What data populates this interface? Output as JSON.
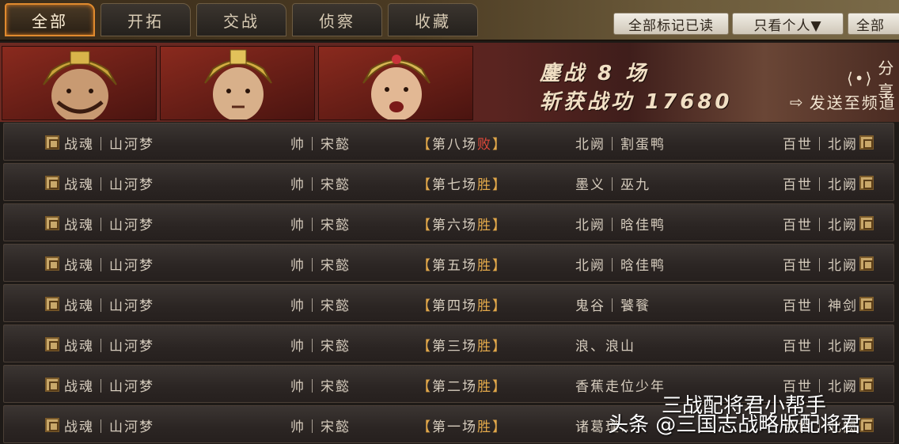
{
  "tabs": [
    {
      "label": "全部",
      "active": true
    },
    {
      "label": "开拓",
      "active": false
    },
    {
      "label": "交战",
      "active": false
    },
    {
      "label": "侦察",
      "active": false
    },
    {
      "label": "收藏",
      "active": false
    }
  ],
  "toolbar": {
    "mark_all_read": "全部标记已读",
    "filter_personal": "只看个人▼",
    "filter_all": "全部"
  },
  "banner": {
    "battles_text": "鏖战 8 场",
    "merit_text": "斩获战功 17680",
    "share_label": "分享",
    "send_label": "发送至频道"
  },
  "battles": [
    {
      "left_team": "战魂｜山河梦",
      "left_general": "帅｜宋懿",
      "round": "第八场",
      "result": "败",
      "result_type": "lose",
      "right_general": "北阙｜割蛋鸭",
      "right_team": "百世｜北阙"
    },
    {
      "left_team": "战魂｜山河梦",
      "left_general": "帅｜宋懿",
      "round": "第七场",
      "result": "胜",
      "result_type": "win",
      "right_general": "墨义｜巫九",
      "right_team": "百世｜北阙"
    },
    {
      "left_team": "战魂｜山河梦",
      "left_general": "帅｜宋懿",
      "round": "第六场",
      "result": "胜",
      "result_type": "win",
      "right_general": "北阙｜晗佳鸭",
      "right_team": "百世｜北阙"
    },
    {
      "left_team": "战魂｜山河梦",
      "left_general": "帅｜宋懿",
      "round": "第五场",
      "result": "胜",
      "result_type": "win",
      "right_general": "北阙｜晗佳鸭",
      "right_team": "百世｜北阙"
    },
    {
      "left_team": "战魂｜山河梦",
      "left_general": "帅｜宋懿",
      "round": "第四场",
      "result": "胜",
      "result_type": "win",
      "right_general": "鬼谷｜饕餮",
      "right_team": "百世｜神剑"
    },
    {
      "left_team": "战魂｜山河梦",
      "left_general": "帅｜宋懿",
      "round": "第三场",
      "result": "胜",
      "result_type": "win",
      "right_general": "浪、浪山",
      "right_team": "百世｜北阙"
    },
    {
      "left_team": "战魂｜山河梦",
      "left_general": "帅｜宋懿",
      "round": "第二场",
      "result": "胜",
      "result_type": "win",
      "right_general": "香蕉走位少年",
      "right_team": "百世｜北阙"
    },
    {
      "left_team": "战魂｜山河梦",
      "left_general": "帅｜宋懿",
      "round": "第一场",
      "result": "胜",
      "result_type": "win",
      "right_general": "诸葛瑾…",
      "right_team": "百世｜北阙"
    }
  ],
  "watermark": {
    "line1": "三战配将君小帮手",
    "line2": "头条 @三国志战略版配将君"
  },
  "colors": {
    "win": "#e2a84a",
    "lose": "#e0483a",
    "active_tab_border": "#e08a2e"
  }
}
